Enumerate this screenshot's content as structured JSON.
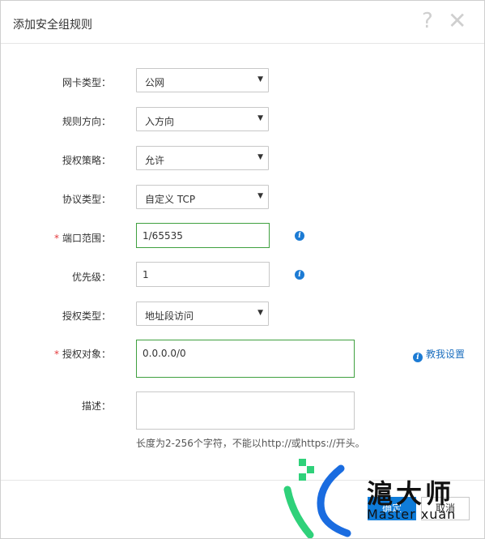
{
  "dialog": {
    "title": "添加安全组规则",
    "help_icon": "question-icon",
    "close_icon": "close-icon"
  },
  "form": {
    "nic_type": {
      "label": "网卡类型：",
      "value": "公网"
    },
    "direction": {
      "label": "规则方向：",
      "value": "入方向"
    },
    "policy": {
      "label": "授权策略：",
      "value": "允许"
    },
    "protocol": {
      "label": "协议类型：",
      "value": "自定义 TCP"
    },
    "port_range": {
      "label": "端口范围：",
      "required_mark": "*",
      "value": "1/65535"
    },
    "priority": {
      "label": "优先级：",
      "value": "1"
    },
    "auth_type": {
      "label": "授权类型：",
      "value": "地址段访问"
    },
    "auth_object": {
      "label": "授权对象：",
      "required_mark": "*",
      "value": "0.0.0.0/0",
      "help_link": "教我设置"
    },
    "description": {
      "label": "描述：",
      "value": "",
      "hint": "长度为2-256个字符，不能以http://或https://开头。"
    }
  },
  "footer": {
    "ok_label": "确定",
    "cancel_label": "取消"
  },
  "watermark": {
    "text": "滬大师",
    "subtext": "Master xuan"
  },
  "colors": {
    "primary": "#0f7cd9",
    "focus_border": "#3fa03f",
    "required": "#e4393c",
    "info_icon": "#1c7bd4",
    "watermark_green": "#2fd17a",
    "watermark_blue": "#1a6ce0"
  }
}
